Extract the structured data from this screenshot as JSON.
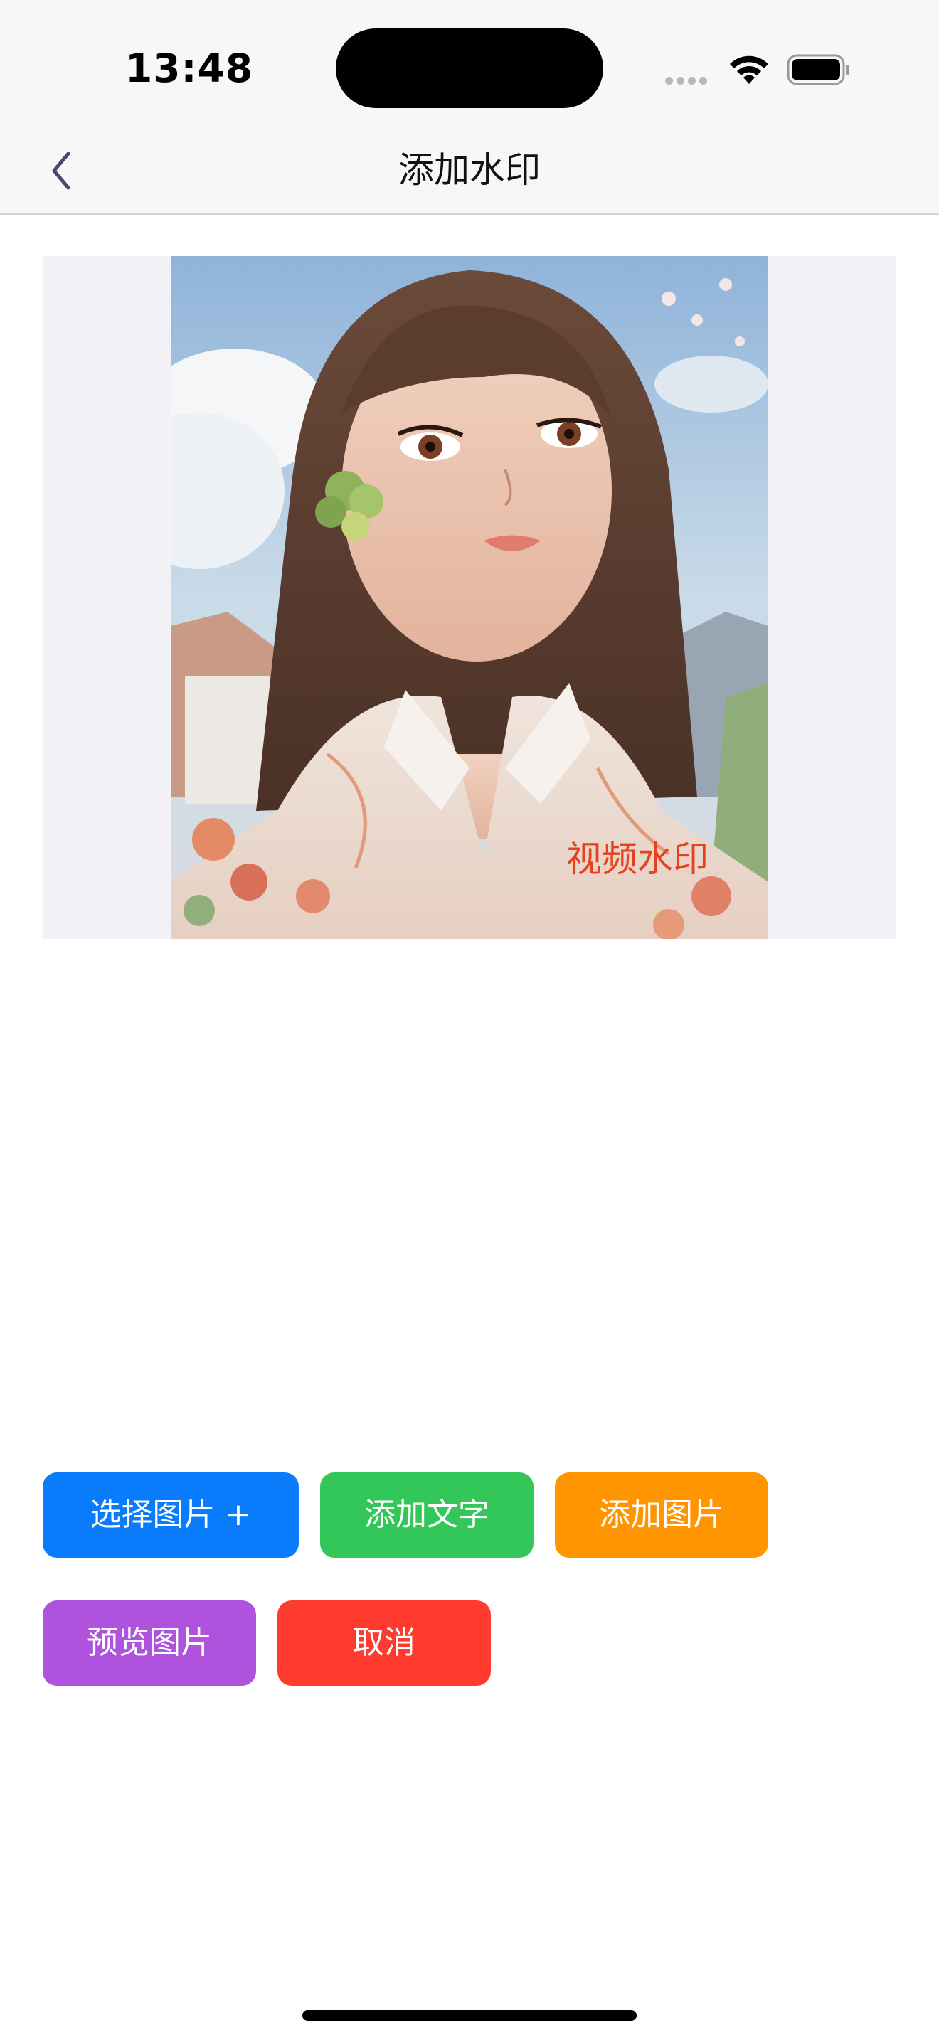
{
  "status": {
    "time": "13:48",
    "icons": [
      "cellular-signal-icon",
      "wifi-icon",
      "battery-icon"
    ]
  },
  "nav": {
    "back_icon": "chevron-left-icon",
    "title": "添加水印"
  },
  "preview": {
    "image_description_icon": "illustrated-girl-portrait-image",
    "watermark_text": "视频水印",
    "watermark_color": "#e8401c",
    "frame_bg": "#f1f1f6"
  },
  "buttons": {
    "select_image": "选择图片 +",
    "add_text": "添加文字",
    "add_image": "添加图片",
    "preview_image": "预览图片",
    "cancel": "取消"
  },
  "colors": {
    "blue": "#0a7cfb",
    "green": "#33c759",
    "orange": "#ff9500",
    "purple": "#af52de",
    "red": "#ff3b30"
  }
}
